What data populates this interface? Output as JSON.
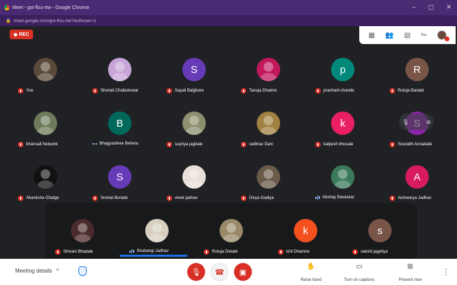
{
  "window": {
    "title": "Meet - gst-flsu-rtw - Google Chrome",
    "url": "meet.google.com/gst-flsu-rtw?authuser=1",
    "controls": [
      "–",
      "▢",
      "✕"
    ]
  },
  "recording": {
    "label": "REC"
  },
  "top_panel": {
    "you_label": "You",
    "icons": [
      "grid-icon",
      "people-icon",
      "chat-icon"
    ]
  },
  "participants": [
    {
      "name": "You",
      "initial": "",
      "color": "#5a4a3a",
      "muted": true
    },
    {
      "name": "Shonali Chabukswar",
      "initial": "",
      "color": "#c7a5d8",
      "muted": true
    },
    {
      "name": "Sayali Balghare",
      "initial": "S",
      "color": "#673ab7",
      "muted": true
    },
    {
      "name": "Tanuja Dhakne",
      "initial": "",
      "color": "#c2185b",
      "muted": true
    },
    {
      "name": "prashant chande",
      "initial": "p",
      "color": "#00897b",
      "muted": true
    },
    {
      "name": "Rutuja Bandal",
      "initial": "R",
      "color": "#795548",
      "muted": true
    },
    {
      "name": "bhansali Network",
      "initial": "",
      "color": "#6d7b5a",
      "muted": true
    },
    {
      "name": "Bhagyashree Behera",
      "initial": "B",
      "color": "#00695c",
      "muted": false,
      "speaking": false
    },
    {
      "name": "supriya jagdale",
      "initial": "",
      "color": "#8d8f6e",
      "muted": true
    },
    {
      "name": "vaibhav Dani",
      "initial": "",
      "color": "#a08040",
      "muted": true
    },
    {
      "name": "kalpesh bhosale",
      "initial": "k",
      "color": "#e91e63",
      "muted": true
    },
    {
      "name": "Sourabh Annadate",
      "initial": "S",
      "color": "#8e24aa",
      "muted": true
    },
    {
      "name": "Akanksha Ghatge",
      "initial": "",
      "color": "#111111",
      "muted": true
    },
    {
      "name": "Snehal Borade",
      "initial": "S",
      "color": "#673ab7",
      "muted": true
    },
    {
      "name": "vivek jadhav",
      "initial": "",
      "color": "#e8e0d8",
      "muted": true
    },
    {
      "name": "Divya Gadiya",
      "initial": "",
      "color": "#6a5a4a",
      "muted": true
    },
    {
      "name": "Akshay Bavaskar",
      "initial": "",
      "color": "#3b7a5a",
      "muted": false,
      "speaking": true
    },
    {
      "name": "Aishwarya Jadhav",
      "initial": "A",
      "color": "#d81b60",
      "muted": true
    },
    {
      "name": "Shivani Bhadale",
      "initial": "",
      "color": "#4a2a2a",
      "muted": true
    },
    {
      "name": "Shubangi Jadhav",
      "initial": "",
      "color": "#d8cfc0",
      "muted": false,
      "speaking": true
    },
    {
      "name": "Rutuja Diwate",
      "initial": "",
      "color": "#9a8a6a",
      "muted": true
    },
    {
      "name": "kirti Dhamne",
      "initial": "k",
      "color": "#f4511e",
      "muted": true
    },
    {
      "name": "sakshi jagetiya",
      "initial": "s",
      "color": "#795548",
      "muted": true
    }
  ],
  "bottom": {
    "meeting_details": "Meeting details",
    "actions": [
      {
        "icon": "hand-icon",
        "glyph": "✋",
        "label": "Raise hand"
      },
      {
        "icon": "captions-icon",
        "glyph": "▭",
        "label": "Turn on captions"
      },
      {
        "icon": "present-icon",
        "glyph": "⊞",
        "label": "Present now"
      }
    ]
  },
  "colors": {
    "accent": "#1a73e8",
    "danger": "#d93025",
    "background": "#202124"
  }
}
